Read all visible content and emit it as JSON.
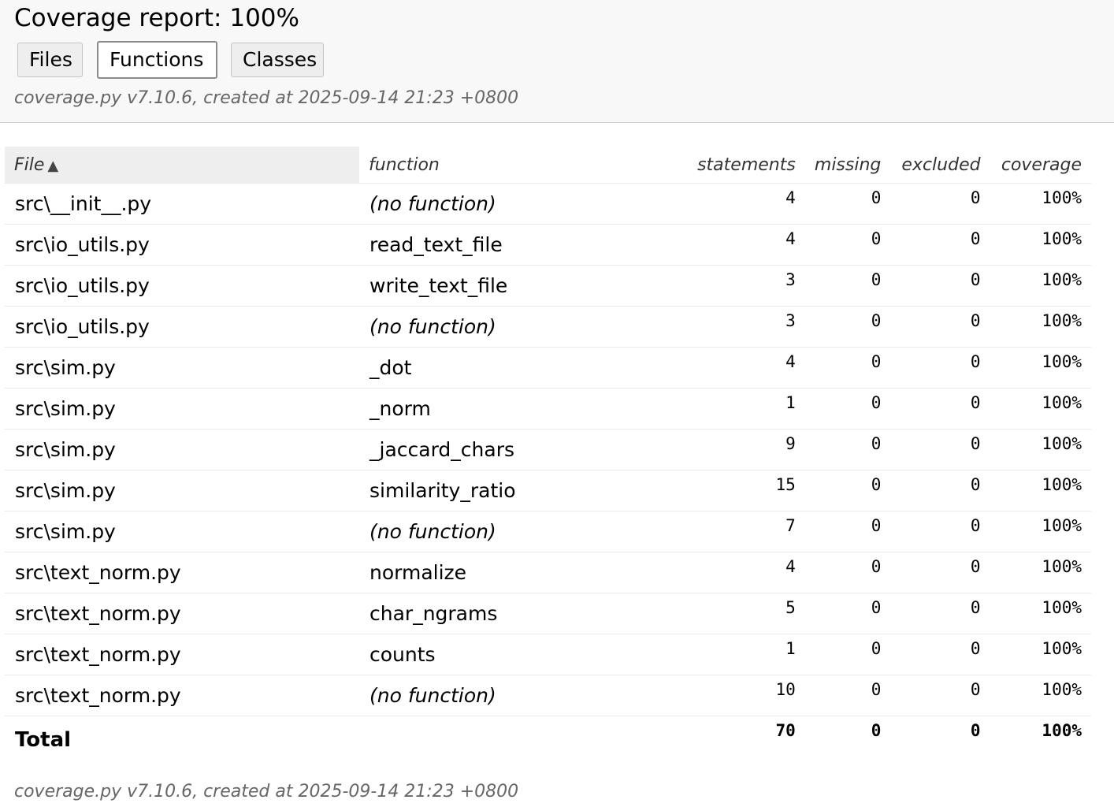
{
  "header": {
    "title": "Coverage report: 100%",
    "buttons": {
      "files": "Files",
      "functions": "Functions",
      "classes": "Classes"
    },
    "meta": "coverage.py v7.10.6, created at 2025-09-14 21:23 +0800"
  },
  "table": {
    "columns": {
      "file": "File",
      "function": "function",
      "statements": "statements",
      "missing": "missing",
      "excluded": "excluded",
      "coverage": "coverage"
    },
    "sort_arrow": "▲",
    "rows": [
      {
        "file": "src\\__init__.py",
        "function": "(no function)",
        "statements": "4",
        "missing": "0",
        "excluded": "0",
        "coverage": "100%"
      },
      {
        "file": "src\\io_utils.py",
        "function": "read_text_file",
        "statements": "4",
        "missing": "0",
        "excluded": "0",
        "coverage": "100%"
      },
      {
        "file": "src\\io_utils.py",
        "function": "write_text_file",
        "statements": "3",
        "missing": "0",
        "excluded": "0",
        "coverage": "100%"
      },
      {
        "file": "src\\io_utils.py",
        "function": "(no function)",
        "statements": "3",
        "missing": "0",
        "excluded": "0",
        "coverage": "100%"
      },
      {
        "file": "src\\sim.py",
        "function": "_dot",
        "statements": "4",
        "missing": "0",
        "excluded": "0",
        "coverage": "100%"
      },
      {
        "file": "src\\sim.py",
        "function": "_norm",
        "statements": "1",
        "missing": "0",
        "excluded": "0",
        "coverage": "100%"
      },
      {
        "file": "src\\sim.py",
        "function": "_jaccard_chars",
        "statements": "9",
        "missing": "0",
        "excluded": "0",
        "coverage": "100%"
      },
      {
        "file": "src\\sim.py",
        "function": "similarity_ratio",
        "statements": "15",
        "missing": "0",
        "excluded": "0",
        "coverage": "100%"
      },
      {
        "file": "src\\sim.py",
        "function": "(no function)",
        "statements": "7",
        "missing": "0",
        "excluded": "0",
        "coverage": "100%"
      },
      {
        "file": "src\\text_norm.py",
        "function": "normalize",
        "statements": "4",
        "missing": "0",
        "excluded": "0",
        "coverage": "100%"
      },
      {
        "file": "src\\text_norm.py",
        "function": "char_ngrams",
        "statements": "5",
        "missing": "0",
        "excluded": "0",
        "coverage": "100%"
      },
      {
        "file": "src\\text_norm.py",
        "function": "counts",
        "statements": "1",
        "missing": "0",
        "excluded": "0",
        "coverage": "100%"
      },
      {
        "file": "src\\text_norm.py",
        "function": "(no function)",
        "statements": "10",
        "missing": "0",
        "excluded": "0",
        "coverage": "100%"
      }
    ],
    "total": {
      "label": "Total",
      "statements": "70",
      "missing": "0",
      "excluded": "0",
      "coverage": "100%"
    }
  },
  "footer": {
    "meta": "coverage.py v7.10.6, created at 2025-09-14 21:23 +0800"
  }
}
